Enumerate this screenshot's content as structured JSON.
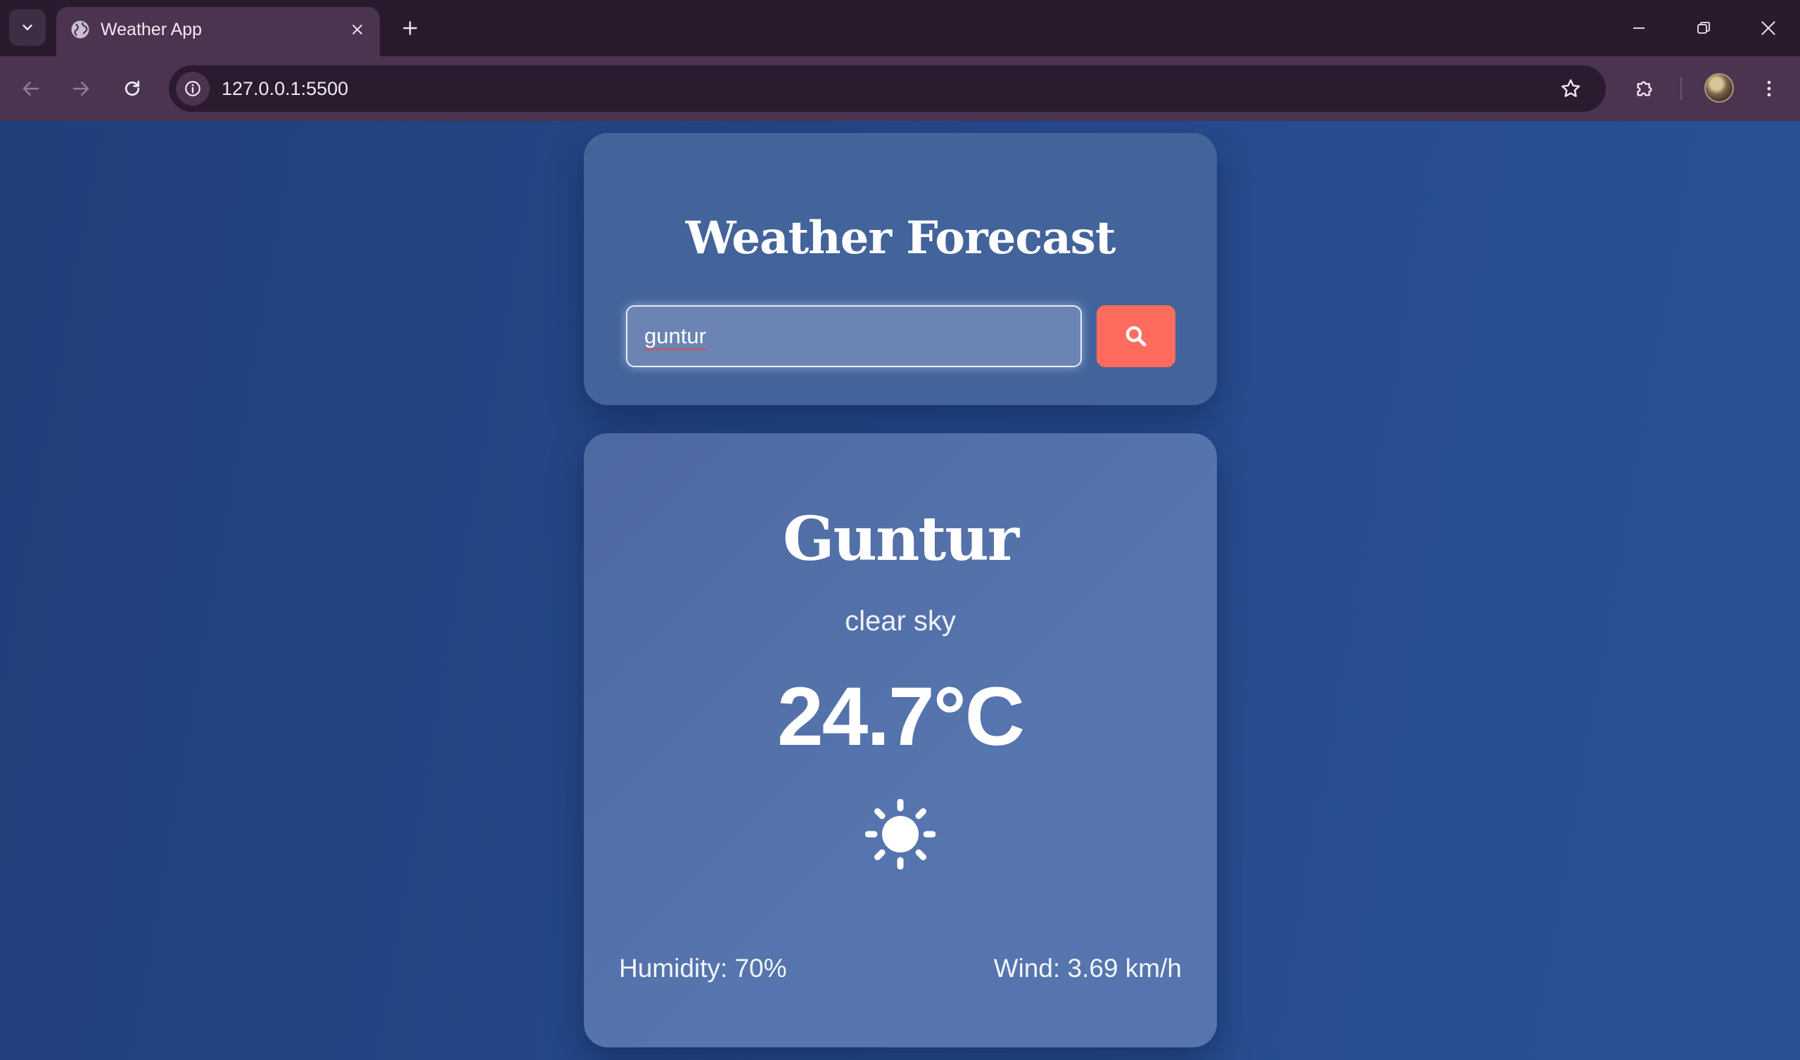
{
  "browser": {
    "tab_title": "Weather App",
    "url": "127.0.0.1:5500",
    "icons": {
      "tab_menu": "chevron-down-icon",
      "favicon": "globe-icon",
      "tab_close": "close-icon",
      "new_tab": "plus-icon",
      "minimize": "minimize-icon",
      "restore": "restore-icon",
      "close_window": "close-icon",
      "back": "arrow-left-icon",
      "forward": "arrow-right-icon",
      "reload": "reload-icon",
      "site_info": "info-icon",
      "bookmark": "star-icon",
      "extensions": "puzzle-icon",
      "menu": "kebab-icon"
    }
  },
  "app": {
    "title": "Weather Forecast",
    "search": {
      "value": "guntur",
      "button_icon": "search-icon"
    },
    "weather": {
      "city": "Guntur",
      "condition": "clear sky",
      "temperature": "24.7°C",
      "icon": "sun-icon",
      "humidity": "Humidity: 70%",
      "wind": "Wind: 3.69 km/h"
    }
  },
  "colors": {
    "page_background": "#234685",
    "card_background": "#4e69a1",
    "search_button": "#ff6b5d",
    "text": "#ffffff"
  }
}
